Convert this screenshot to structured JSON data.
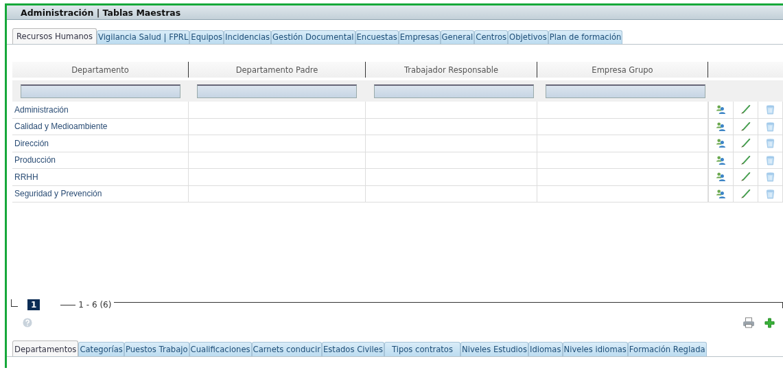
{
  "window": {
    "title": "Administración | Tablas Maestras"
  },
  "tabs": [
    {
      "label": "Recursos Humanos",
      "selected": true
    },
    {
      "label": "Vigilancia Salud | FPRL",
      "selected": false
    },
    {
      "label": "Equipos",
      "selected": false
    },
    {
      "label": "Incidencias",
      "selected": false
    },
    {
      "label": "Gestión Documental",
      "selected": false
    },
    {
      "label": "Encuestas",
      "selected": false
    },
    {
      "label": "Empresas",
      "selected": false
    },
    {
      "label": "General",
      "selected": false
    },
    {
      "label": "Centros",
      "selected": false
    },
    {
      "label": "Objetivos",
      "selected": false
    },
    {
      "label": "Plan de formación",
      "selected": false
    }
  ],
  "table": {
    "columns": [
      "Departamento",
      "Departamento Padre",
      "Trabajador Responsable",
      "Empresa Grupo"
    ],
    "rows": [
      {
        "departamento": "Administración"
      },
      {
        "departamento": "Calidad y Medioambiente"
      },
      {
        "departamento": "Dirección"
      },
      {
        "departamento": "Producción"
      },
      {
        "departamento": "RRHH"
      },
      {
        "departamento": "Seguridad y Prevención"
      }
    ]
  },
  "pagination": {
    "pages": [
      {
        "label": "1",
        "selected": true
      }
    ],
    "range": "1 - 6 (6)"
  },
  "bottom_tabs": [
    {
      "label": "Departamentos",
      "selected": true
    },
    {
      "label": "Categorías",
      "selected": false
    },
    {
      "label": "Puestos Trabajo",
      "selected": false
    },
    {
      "label": "Cualificaciones",
      "selected": false
    },
    {
      "label": "Carnets conducir",
      "selected": false
    },
    {
      "label": "Estados Civiles",
      "selected": false
    },
    {
      "label": "Tipos contratos",
      "selected": false
    },
    {
      "label": "Niveles Estudios",
      "selected": false
    },
    {
      "label": "Idiomas",
      "selected": false
    },
    {
      "label": "Niveles idiomas",
      "selected": false
    },
    {
      "label": "Formación Reglada",
      "selected": false
    }
  ]
}
